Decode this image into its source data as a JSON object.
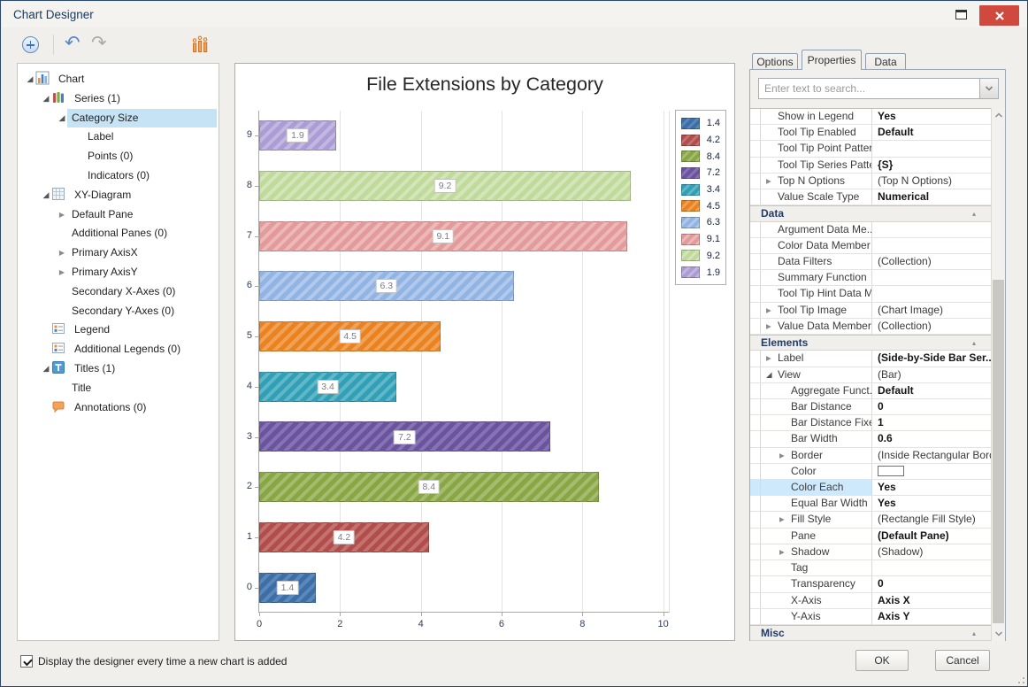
{
  "window": {
    "title": "Chart Designer"
  },
  "toolbar": {
    "buttons": [
      "add-chart-element",
      "undo",
      "redo",
      "change-chart-type"
    ]
  },
  "tree": {
    "items": [
      {
        "label": "Chart",
        "depth": 0,
        "expander": "open",
        "icon": "chart-icon"
      },
      {
        "label": "Series (1)",
        "depth": 1,
        "expander": "open",
        "icon": "series-icon"
      },
      {
        "label": "Category Size",
        "depth": 2,
        "expander": "open",
        "icon": null,
        "selected": true
      },
      {
        "label": "Label",
        "depth": 3,
        "expander": null,
        "icon": null
      },
      {
        "label": "Points (0)",
        "depth": 3,
        "expander": null,
        "icon": null
      },
      {
        "label": "Indicators (0)",
        "depth": 3,
        "expander": null,
        "icon": null
      },
      {
        "label": "XY-Diagram",
        "depth": 1,
        "expander": "open",
        "icon": "grid-icon"
      },
      {
        "label": "Default Pane",
        "depth": 2,
        "expander": "closed",
        "icon": null
      },
      {
        "label": "Additional Panes (0)",
        "depth": 2,
        "expander": null,
        "icon": null
      },
      {
        "label": "Primary AxisX",
        "depth": 2,
        "expander": "closed",
        "icon": null
      },
      {
        "label": "Primary AxisY",
        "depth": 2,
        "expander": "closed",
        "icon": null
      },
      {
        "label": "Secondary X-Axes (0)",
        "depth": 2,
        "expander": null,
        "icon": null
      },
      {
        "label": "Secondary Y-Axes (0)",
        "depth": 2,
        "expander": null,
        "icon": null
      },
      {
        "label": "Legend",
        "depth": 1,
        "expander": null,
        "icon": "legend-icon"
      },
      {
        "label": "Additional Legends (0)",
        "depth": 1,
        "expander": null,
        "icon": "legend-icon"
      },
      {
        "label": "Titles (1)",
        "depth": 1,
        "expander": "open",
        "icon": "title-icon"
      },
      {
        "label": "Title",
        "depth": 2,
        "expander": null,
        "icon": null
      },
      {
        "label": "Annotations (0)",
        "depth": 1,
        "expander": null,
        "icon": "annotation-icon"
      }
    ]
  },
  "chart_data": {
    "type": "bar",
    "orientation": "horizontal",
    "title": "File Extensions by Category",
    "categories": [
      "0",
      "1",
      "2",
      "3",
      "4",
      "5",
      "6",
      "7",
      "8",
      "9"
    ],
    "values": [
      1.4,
      4.2,
      8.4,
      7.2,
      3.4,
      4.5,
      6.3,
      9.1,
      9.2,
      1.9
    ],
    "bar_colors": [
      "#3d6ea5",
      "#b14d4a",
      "#89a644",
      "#6b539d",
      "#31a0b6",
      "#e9821f",
      "#92b4e2",
      "#e39a9a",
      "#c0da9b",
      "#ab9cd4"
    ],
    "bar_stripe_colors": [
      "#5c87bb",
      "#c47270",
      "#a3bc6d",
      "#8673b3",
      "#5fb7c8",
      "#f0a155",
      "#b0c9ec",
      "#edb8b8",
      "#d4e6b9",
      "#c2b7e0"
    ],
    "value_labels": [
      "1.4",
      "4.2",
      "8.4",
      "7.2",
      "3.4",
      "4.5",
      "6.3",
      "9.1",
      "9.2",
      "1.9"
    ],
    "x_ticks": [
      0,
      2,
      4,
      6,
      8,
      10
    ],
    "xlim": [
      0,
      10.14
    ],
    "grid": true,
    "legend_position": "top-right",
    "legend_labels": [
      "1.4",
      "4.2",
      "8.4",
      "7.2",
      "3.4",
      "4.5",
      "6.3",
      "9.1",
      "9.2",
      "1.9"
    ]
  },
  "properties_panel": {
    "tabs": [
      {
        "label": "Options",
        "active": false
      },
      {
        "label": "Properties",
        "active": true
      },
      {
        "label": "Data",
        "active": false
      }
    ],
    "search_placeholder": "Enter text to search...",
    "rows": [
      {
        "kind": "prop",
        "name": "Show in Legend",
        "value": "Yes",
        "bold": true
      },
      {
        "kind": "prop",
        "name": "Tool Tip Enabled",
        "value": "Default",
        "bold": true
      },
      {
        "kind": "prop",
        "name": "Tool Tip Point Pattern",
        "value": ""
      },
      {
        "kind": "prop",
        "name": "Tool Tip Series Pattern",
        "value": "{S}",
        "bold": true
      },
      {
        "kind": "prop",
        "name": "Top N Options",
        "value": "(Top N Options)",
        "expander": "closed"
      },
      {
        "kind": "prop",
        "name": "Value Scale Type",
        "value": "Numerical",
        "bold": true
      },
      {
        "kind": "cat",
        "name": "Data"
      },
      {
        "kind": "prop",
        "name": "Argument Data Me...",
        "value": ""
      },
      {
        "kind": "prop",
        "name": "Color Data Member",
        "value": ""
      },
      {
        "kind": "prop",
        "name": "Data Filters",
        "value": "(Collection)"
      },
      {
        "kind": "prop",
        "name": "Summary Function",
        "value": ""
      },
      {
        "kind": "prop",
        "name": "Tool Tip Hint Data M...",
        "value": ""
      },
      {
        "kind": "prop",
        "name": "Tool Tip Image",
        "value": "(Chart Image)",
        "expander": "closed"
      },
      {
        "kind": "prop",
        "name": "Value Data Members",
        "value": "(Collection)",
        "expander": "closed"
      },
      {
        "kind": "cat",
        "name": "Elements"
      },
      {
        "kind": "prop",
        "name": "Label",
        "value": "(Side-by-Side Bar Ser...",
        "bold": true,
        "expander": "closed"
      },
      {
        "kind": "prop",
        "name": "View",
        "value": "(Bar)",
        "expander": "open"
      },
      {
        "kind": "prop",
        "name": "Aggregate Funct...",
        "value": "Default",
        "bold": true,
        "nested": true
      },
      {
        "kind": "prop",
        "name": "Bar Distance",
        "value": "0",
        "bold": true,
        "nested": true
      },
      {
        "kind": "prop",
        "name": "Bar Distance Fixed",
        "value": "1",
        "bold": true,
        "nested": true
      },
      {
        "kind": "prop",
        "name": "Bar Width",
        "value": "0.6",
        "bold": true,
        "nested": true
      },
      {
        "kind": "prop",
        "name": "Border",
        "value": "(Inside Rectangular Bord...",
        "nested": true,
        "expander": "closed"
      },
      {
        "kind": "prop",
        "name": "Color",
        "value": "",
        "nested": true,
        "swatch": true
      },
      {
        "kind": "prop",
        "name": "Color Each",
        "value": "Yes",
        "bold": true,
        "nested": true,
        "selected": true
      },
      {
        "kind": "prop",
        "name": "Equal Bar Width",
        "value": "Yes",
        "bold": true,
        "nested": true
      },
      {
        "kind": "prop",
        "name": "Fill Style",
        "value": "(Rectangle Fill Style)",
        "nested": true,
        "expander": "closed"
      },
      {
        "kind": "prop",
        "name": "Pane",
        "value": "(Default Pane)",
        "bold": true,
        "nested": true
      },
      {
        "kind": "prop",
        "name": "Shadow",
        "value": "(Shadow)",
        "nested": true,
        "expander": "closed"
      },
      {
        "kind": "prop",
        "name": "Tag",
        "value": "",
        "nested": true
      },
      {
        "kind": "prop",
        "name": "Transparency",
        "value": "0",
        "bold": true,
        "nested": true
      },
      {
        "kind": "prop",
        "name": "X-Axis",
        "value": "Axis X",
        "bold": true,
        "nested": true
      },
      {
        "kind": "prop",
        "name": "Y-Axis",
        "value": "Axis Y",
        "bold": true,
        "nested": true
      },
      {
        "kind": "cat",
        "name": "Misc"
      }
    ]
  },
  "footer": {
    "checkbox_label": "Display the designer every time a new chart is added",
    "checkbox_checked": true,
    "ok_label": "OK",
    "cancel_label": "Cancel"
  },
  "colors": {
    "window_border": "#29486b",
    "close_button": "#d0493f",
    "selection_blue": "#c6e2f5",
    "category_text": "#1e3c6e"
  }
}
